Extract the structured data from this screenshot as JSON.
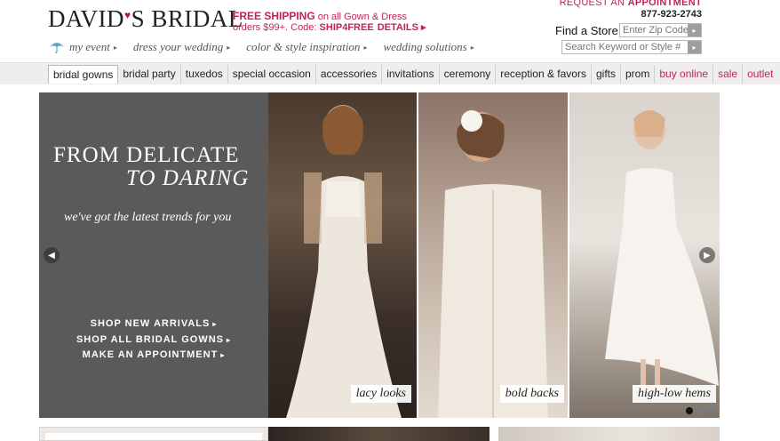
{
  "header": {
    "logo_prefix": "DAVID",
    "logo_heart": "♥",
    "logo_suffix": "S BRIDAL",
    "promo_line1_big": "FREE SHIPPING",
    "promo_line1_rest": " on all Gown & Dress",
    "promo_line2_prefix": "orders $99+. Code: ",
    "promo_code": "SHIP4FREE",
    "promo_details": "DETAILS ▸",
    "request_prefix": "REQUEST AN ",
    "request_bold": "APPOINTMENT",
    "phone": "877-923-2743",
    "find_store": "Find a Store",
    "zip_placeholder": "Enter Zip Code",
    "search_placeholder": "Search Keyword or Style #",
    "go_icon": "▸"
  },
  "subnav": [
    {
      "label": "my event"
    },
    {
      "label": "dress your wedding"
    },
    {
      "label": "color & style inspiration"
    },
    {
      "label": "wedding solutions"
    }
  ],
  "subnav_arrow": "▸",
  "mainnav": [
    {
      "label": "bridal gowns"
    },
    {
      "label": "bridal party"
    },
    {
      "label": "tuxedos"
    },
    {
      "label": "special occasion"
    },
    {
      "label": "accessories"
    },
    {
      "label": "invitations"
    },
    {
      "label": "ceremony"
    },
    {
      "label": "reception & favors"
    },
    {
      "label": "gifts"
    },
    {
      "label": "prom"
    },
    {
      "label": "buy online"
    },
    {
      "label": "sale"
    },
    {
      "label": "outlet"
    }
  ],
  "hero": {
    "title_line1": "FROM DELICATE",
    "title_line2": "TO DARING",
    "tagline": "we've got the latest trends for you",
    "links": [
      {
        "label": "SHOP NEW ARRIVALS"
      },
      {
        "label": "SHOP ALL BRIDAL GOWNS"
      },
      {
        "label": "MAKE AN APPOINTMENT"
      }
    ],
    "link_arrow": "▸",
    "captions": [
      "lacy looks",
      "bold backs",
      "high-low hems"
    ],
    "prev_icon": "◀",
    "next_icon": "▶",
    "slide_count": 3,
    "active_slide": 1
  },
  "colors": {
    "brand_pink": "#c4205d",
    "hero_gray": "#5a5a5a",
    "nav_bg": "#f0eeed"
  }
}
